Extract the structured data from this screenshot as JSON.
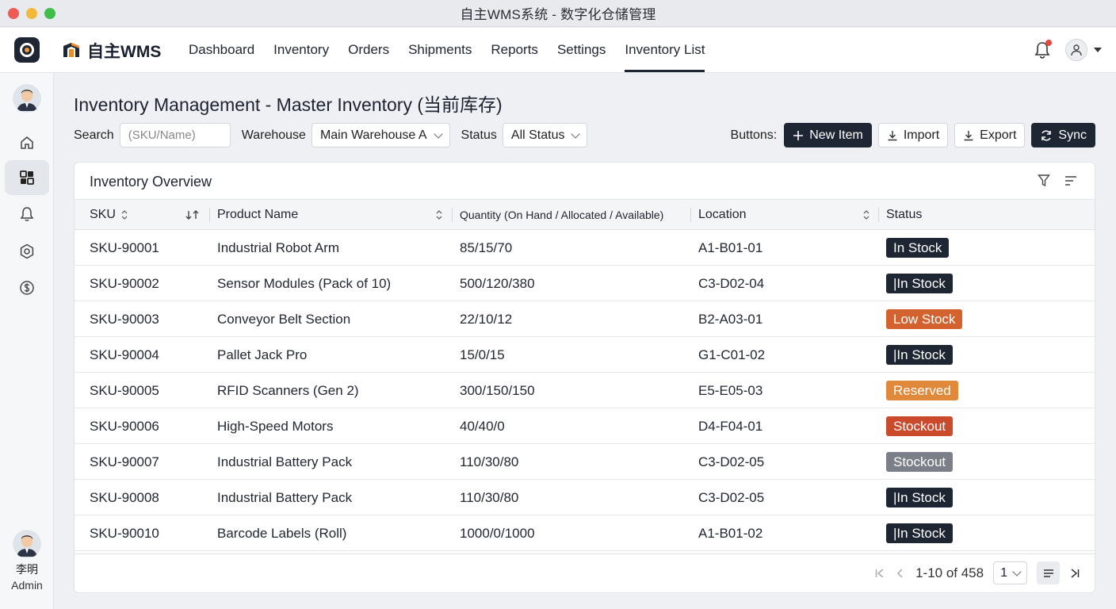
{
  "window": {
    "title": "自主WMS系统 - 数字化仓储管理"
  },
  "brand": {
    "name": "自主WMS"
  },
  "nav": {
    "links": [
      {
        "label": "Dashboard"
      },
      {
        "label": "Inventory"
      },
      {
        "label": "Orders"
      },
      {
        "label": "Shipments"
      },
      {
        "label": "Reports"
      },
      {
        "label": "Settings"
      },
      {
        "label": "Inventory List",
        "active": true
      }
    ]
  },
  "sidebar": {
    "items": [
      {
        "icon": "home-icon"
      },
      {
        "icon": "dashboard-grid-icon",
        "active": true
      },
      {
        "icon": "bell-icon"
      },
      {
        "icon": "settings-gear-icon"
      },
      {
        "icon": "dollar-icon"
      }
    ],
    "user": {
      "name": "李明",
      "role": "Admin"
    }
  },
  "page": {
    "title": "Inventory Management - Master Inventory (当前库存)"
  },
  "filters": {
    "search_label": "Search",
    "search_placeholder": "(SKU/Name)",
    "warehouse_label": "Warehouse",
    "warehouse_value": "Main Warehouse A",
    "status_label": "Status",
    "status_value": "All Status"
  },
  "actions": {
    "label": "Buttons:",
    "new_item": "New Item",
    "import": "Import",
    "export": "Export",
    "sync": "Sync"
  },
  "card": {
    "title": "Inventory Overview"
  },
  "table": {
    "columns": {
      "sku": "SKU",
      "name": "Product Name",
      "qty": "Quantity (On Hand / Allocated / Available)",
      "location": "Location",
      "status": "Status"
    },
    "rows": [
      {
        "sku": "SKU-90001",
        "name": "Industrial Robot Arm",
        "qty": "85/15/70",
        "location": "A1-B01-01",
        "status": "In Stock",
        "color": "#1f2633"
      },
      {
        "sku": "SKU-90002",
        "name": "Sensor Modules (Pack of 10)",
        "qty": "500/120/380",
        "location": "C3-D02-04",
        "status": "|In Stock",
        "color": "#1f2633"
      },
      {
        "sku": "SKU-90003",
        "name": "Conveyor Belt Section",
        "qty": "22/10/12",
        "location": "B2-A03-01",
        "status": "Low Stock",
        "color": "#d4622e"
      },
      {
        "sku": "SKU-90004",
        "name": "Pallet Jack Pro",
        "qty": "15/0/15",
        "location": "G1-C01-02",
        "status": "|In Stock",
        "color": "#1f2633"
      },
      {
        "sku": "SKU-90005",
        "name": "RFID Scanners (Gen 2)",
        "qty": "300/150/150",
        "location": "E5-E05-03",
        "status": "Reserved",
        "color": "#e0893a"
      },
      {
        "sku": "SKU-90006",
        "name": "High-Speed Motors",
        "qty": "40/40/0",
        "location": "D4-F04-01",
        "status": "Stockout",
        "color": "#cc4a2c"
      },
      {
        "sku": "SKU-90007",
        "name": "Industrial Battery Pack",
        "qty": "110/30/80",
        "location": "C3-D02-05",
        "status": "Stockout",
        "color": "#7b7f88"
      },
      {
        "sku": "SKU-90008",
        "name": "Industrial Battery Pack",
        "qty": "110/30/80",
        "location": "C3-D02-05",
        "status": "|In Stock",
        "color": "#1f2633"
      },
      {
        "sku": "SKU-90010",
        "name": "Barcode Labels (Roll)",
        "qty": "1000/0/1000",
        "location": "A1-B01-02",
        "status": "|In Stock",
        "color": "#1f2633"
      }
    ]
  },
  "pagination": {
    "range": "1-10 of 458",
    "page": "1"
  }
}
